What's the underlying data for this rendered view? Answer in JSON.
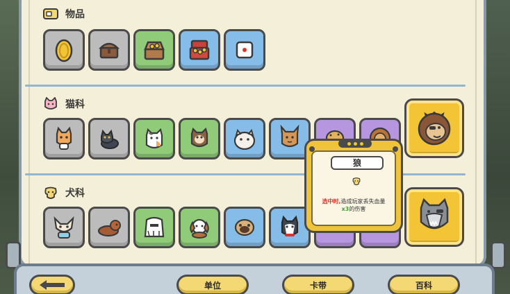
{
  "sections": {
    "items": {
      "title": "物品",
      "icon": "ticket-icon"
    },
    "cats": {
      "title": "猫科",
      "icon": "cat-face-icon"
    },
    "dogs": {
      "title": "犬科",
      "icon": "dog-face-icon"
    }
  },
  "items_row": [
    {
      "name": "gold-coin",
      "color": "gray"
    },
    {
      "name": "treasure-box-closed",
      "color": "gray"
    },
    {
      "name": "treasure-chest-gold",
      "color": "green"
    },
    {
      "name": "treasure-hoard",
      "color": "blue"
    },
    {
      "name": "dice",
      "color": "blue"
    }
  ],
  "cats_row": [
    {
      "name": "orange-cat",
      "color": "gray"
    },
    {
      "name": "black-cat",
      "color": "gray"
    },
    {
      "name": "calico-cat",
      "color": "green"
    },
    {
      "name": "brown-cat",
      "color": "green"
    },
    {
      "name": "persian-cat",
      "color": "blue"
    },
    {
      "name": "lynx",
      "color": "blue"
    },
    {
      "name": "cheetah",
      "color": "purple"
    },
    {
      "name": "lion",
      "color": "purple"
    }
  ],
  "dogs_row": [
    {
      "name": "chihuahua",
      "color": "gray"
    },
    {
      "name": "dachshund",
      "color": "gray"
    },
    {
      "name": "maltese",
      "color": "green"
    },
    {
      "name": "beagle",
      "color": "green"
    },
    {
      "name": "pug",
      "color": "blue"
    },
    {
      "name": "husky",
      "color": "blue"
    },
    {
      "name": "hidden-dog-1",
      "color": "purple"
    },
    {
      "name": "hidden-dog-2",
      "color": "purple"
    }
  ],
  "featured": {
    "cats": "lion-boss-portrait",
    "dogs": "wolf-portrait"
  },
  "tooltip": {
    "title": "狼",
    "desc_red": "选中时,",
    "desc_normal": "造成玩家丢失血量",
    "desc_green": "x3",
    "desc_tail": "的伤害"
  },
  "nav": {
    "back": "back-arrow-icon",
    "units": "单位",
    "tape": "卡带",
    "encyclopedia": "百科"
  },
  "colors": {
    "gray": "#bcbcbc",
    "green": "#8fcb78",
    "blue": "#86bde8",
    "purple": "#b796e0",
    "gold": "#f2c436"
  }
}
